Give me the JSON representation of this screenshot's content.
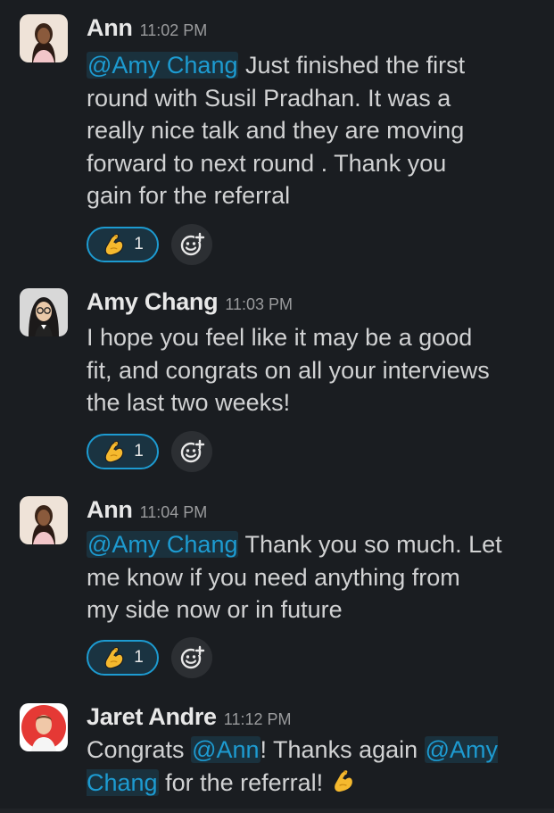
{
  "messages": [
    {
      "author": "Ann",
      "time": "11:02 PM",
      "mention": "@Amy Chang",
      "lines": [
        " Just finished the first",
        "round with Susil Pradhan. It was  a",
        "really nice talk  and they are moving",
        "forward to next round .  Thank you",
        "gain for the referral"
      ],
      "reaction": {
        "emoji": "flexed-biceps",
        "count": "1"
      }
    },
    {
      "author": "Amy Chang",
      "time": "11:03 PM",
      "lines": [
        "I hope you feel like it may be a good",
        "fit, and congrats on all your interviews",
        "the last two weeks!"
      ],
      "reaction": {
        "emoji": "flexed-biceps",
        "count": "1"
      }
    },
    {
      "author": "Ann",
      "time": "11:04 PM",
      "mention": "@Amy Chang",
      "lines": [
        " Thank you so much. Let",
        "me know if you need anything from",
        "my side now or in future"
      ],
      "reaction": {
        "emoji": "flexed-biceps",
        "count": "1"
      }
    },
    {
      "author": "Jaret Andre",
      "time": "11:12 PM",
      "parts": {
        "a": "Congrats ",
        "mention1": "@Ann",
        "b": "! Thanks again ",
        "mention2a": "@Amy",
        "mention2b": "Chang",
        "c": " for the referral! "
      },
      "trailing_emoji": "flexed-biceps"
    }
  ],
  "colors": {
    "background": "#1a1d21",
    "mention": "#1d9bd1",
    "reaction_border": "#1d9bd1",
    "text": "#d1d2d3",
    "timestamp": "#9a9b9d"
  }
}
